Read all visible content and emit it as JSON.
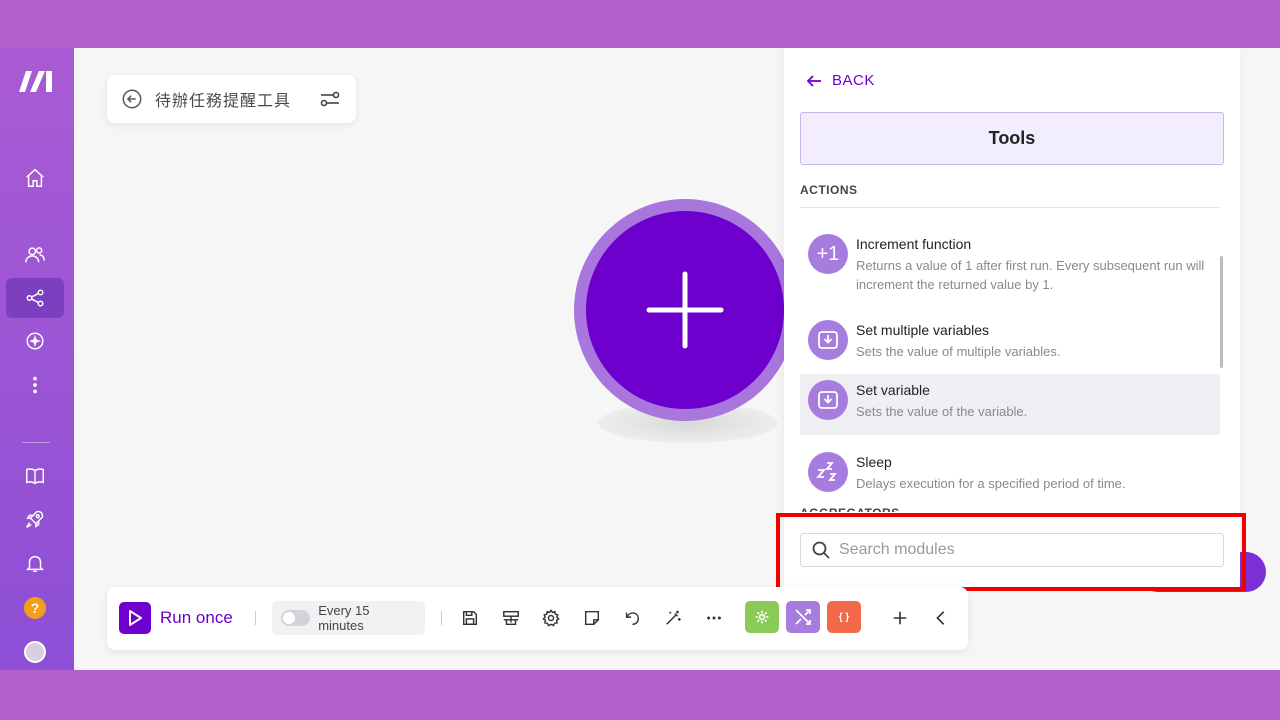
{
  "scenario": {
    "name": "待辦任務提醒工具"
  },
  "panel": {
    "back_label": "BACK",
    "app_title": "Tools",
    "section_actions": "ACTIONS",
    "section_aggregators": "AGGREGATORS",
    "items": [
      {
        "title": "Increment function",
        "desc": "Returns a value of 1 after first run. Every subsequent run will increment the returned value by 1.",
        "icon": "plus-one-icon",
        "icon_text": "+1"
      },
      {
        "title": "Set multiple variables",
        "desc": "Sets the value of multiple variables.",
        "icon": "set-variables-icon"
      },
      {
        "title": "Set variable",
        "desc": "Sets the value of the variable.",
        "icon": "set-variable-icon"
      },
      {
        "title": "Sleep",
        "desc": "Delays execution for a specified period of time.",
        "icon": "sleep-icon"
      }
    ],
    "search_placeholder": "Search modules"
  },
  "toolbar": {
    "run_label": "Run once",
    "schedule_label": "Every 15 minutes",
    "json_badge": "{ }"
  },
  "colors": {
    "brand": "#6d00cc",
    "module_icon": "#a67ddf",
    "highlight": "#ee0000"
  }
}
